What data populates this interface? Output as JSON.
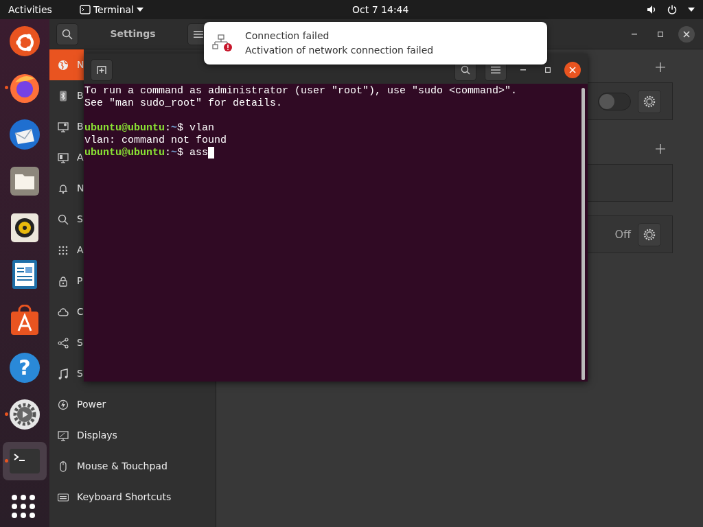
{
  "top_bar": {
    "activities": "Activities",
    "app_menu": "Terminal",
    "clock": "Oct 7  14:44"
  },
  "dock": [
    {
      "kind": "ubuntu",
      "running": false,
      "selected": false
    },
    {
      "kind": "firefox",
      "running": true,
      "selected": false
    },
    {
      "kind": "thunderbird",
      "running": false,
      "selected": false
    },
    {
      "kind": "files",
      "running": false,
      "selected": false
    },
    {
      "kind": "rhythmbox",
      "running": false,
      "selected": false
    },
    {
      "kind": "writer",
      "running": false,
      "selected": false
    },
    {
      "kind": "software",
      "running": false,
      "selected": false
    },
    {
      "kind": "help",
      "glyph": "?",
      "running": false,
      "selected": false
    },
    {
      "kind": "settings",
      "running": true,
      "selected": false
    },
    {
      "kind": "terminal",
      "running": true,
      "selected": true
    },
    {
      "kind": "apps",
      "running": false,
      "selected": false
    }
  ],
  "settings_window": {
    "title": "Settings",
    "sidebar": [
      {
        "kind": "globe",
        "label": "N",
        "selected": true
      },
      {
        "kind": "bluetooth",
        "label": "B",
        "selected": false
      },
      {
        "kind": "background",
        "label": "B",
        "selected": false
      },
      {
        "kind": "appearance",
        "label": "A",
        "selected": false
      },
      {
        "kind": "bell",
        "label": "N",
        "selected": false
      },
      {
        "kind": "search",
        "label": "S",
        "selected": false
      },
      {
        "kind": "grid",
        "label": "A",
        "selected": false
      },
      {
        "kind": "lock",
        "label": "P",
        "selected": false
      },
      {
        "kind": "cloud",
        "label": "C",
        "selected": false
      },
      {
        "kind": "share",
        "label": "S",
        "selected": false
      },
      {
        "kind": "music",
        "label": "S",
        "selected": false
      },
      {
        "kind": "power",
        "label": "Power",
        "selected": false
      },
      {
        "kind": "display",
        "label": "Displays",
        "selected": false
      },
      {
        "kind": "mouse",
        "label": "Mouse & Touchpad",
        "selected": false
      },
      {
        "kind": "keyboard",
        "label": "Keyboard Shortcuts",
        "selected": false
      }
    ],
    "panel": [
      {
        "kind": "add"
      },
      {
        "kind": "card",
        "switch_on": false,
        "settings": true
      },
      {
        "kind": "add"
      },
      {
        "kind": "card"
      },
      {
        "kind": "card",
        "status": "Off",
        "settings": true
      }
    ]
  },
  "terminal": {
    "lines": [
      {
        "kind": "output",
        "text": "To run a command as administrator (user \"root\"), use \"sudo <command>\"."
      },
      {
        "kind": "output",
        "text": "See \"man sudo_root\" for details."
      },
      {
        "kind": "blank"
      },
      {
        "kind": "prompt",
        "host": "ubuntu@ubuntu",
        "sep": ":",
        "path": "~",
        "symbol": "$",
        "command": "vlan",
        "cursor": false
      },
      {
        "kind": "output",
        "text": "vlan: command not found"
      },
      {
        "kind": "prompt",
        "host": "ubuntu@ubuntu",
        "sep": ":",
        "path": "~",
        "symbol": "$",
        "command": "ass",
        "cursor": true
      }
    ]
  },
  "notification": {
    "title": "Connection failed",
    "body": "Activation of network connection failed"
  }
}
